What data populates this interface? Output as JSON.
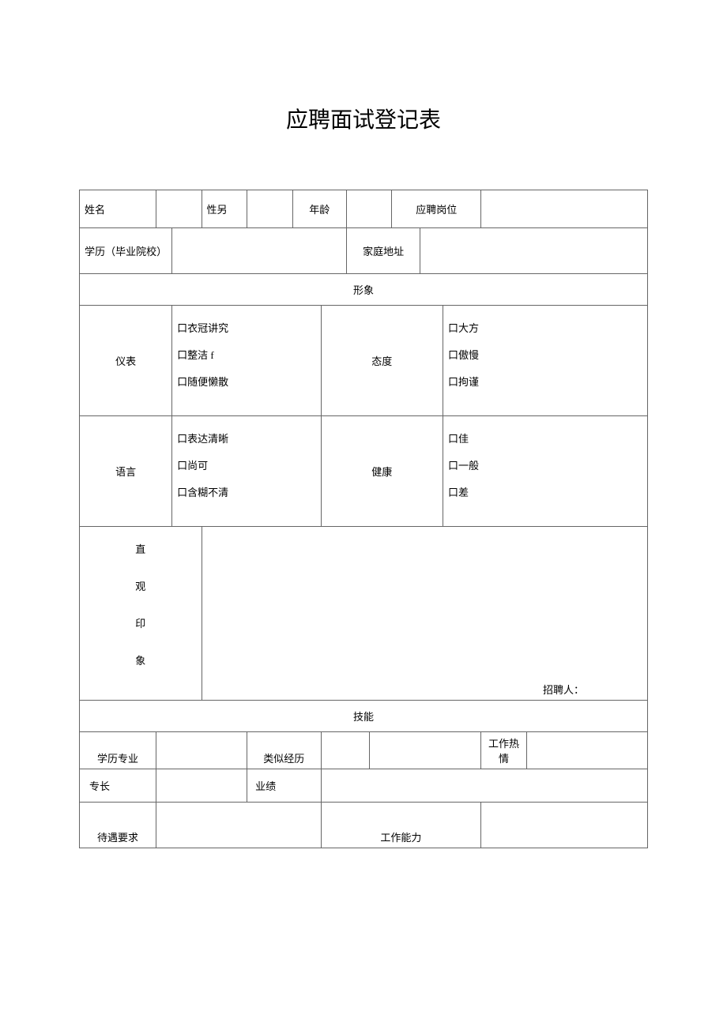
{
  "title": "应聘面试登记表",
  "labels": {
    "name": "姓名",
    "gender": "性另",
    "age": "年龄",
    "position": "应聘岗位",
    "education": "学历（毕业院校）",
    "address": "家庭地址",
    "image_section": "形象",
    "appearance": "仪表",
    "attitude": "态度",
    "language": "语言",
    "health": "健康",
    "impression_c1": "直",
    "impression_c2": "观",
    "impression_c3": "印",
    "impression_c4": "象",
    "recruiter": "招聘人：",
    "skills_section": "技能",
    "major": "学历专业",
    "similar_exp": "类似经历",
    "enthusiasm": "工作热情",
    "strength": "专长",
    "performance": "业绩",
    "salary": "待遇要求",
    "ability": "工作能力"
  },
  "options": {
    "appearance": [
      "口衣冠讲究",
      "口整洁 f",
      "口随便懒散"
    ],
    "attitude": [
      "口大方",
      "口傲慢",
      "口拘谨"
    ],
    "language": [
      "口表达清晰",
      "口尚可",
      "口含糊不清"
    ],
    "health": [
      "口佳",
      "口一般",
      "口差"
    ]
  }
}
